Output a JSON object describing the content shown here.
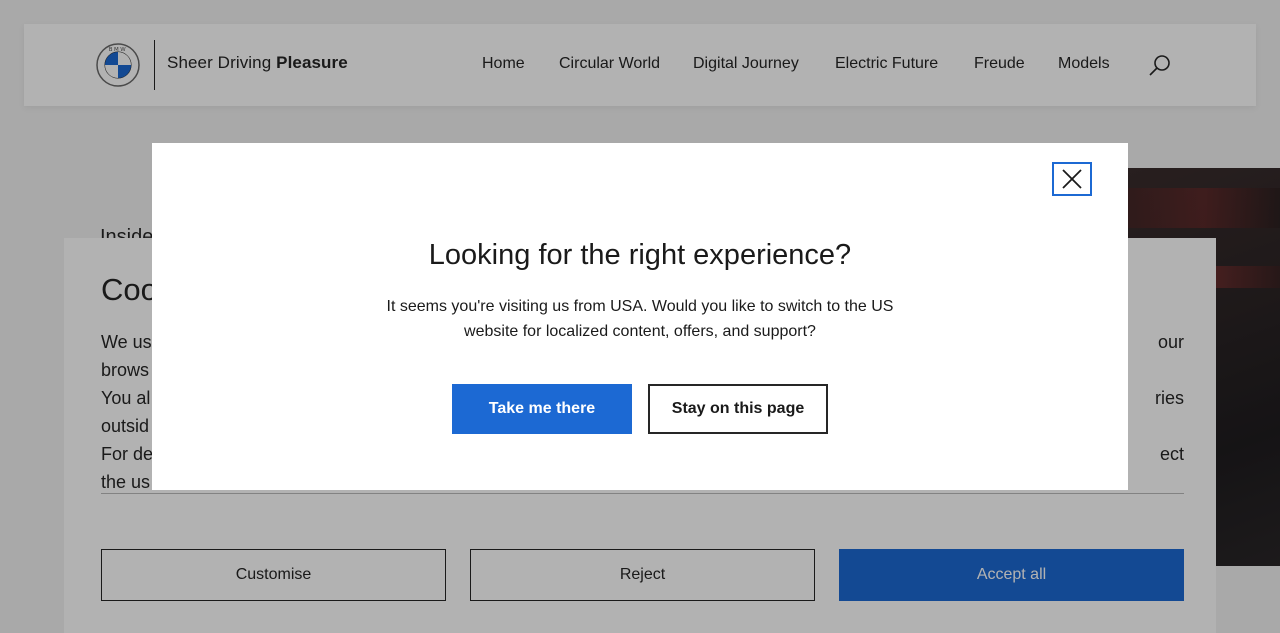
{
  "header": {
    "tagline_regular": "Sheer Driving",
    "tagline_bold": "Pleasure",
    "nav": [
      "Home",
      "Circular World",
      "Digital Journey",
      "Electric Future",
      "Freude",
      "Models"
    ],
    "search_icon": "search-icon",
    "logo_letters": "BMW"
  },
  "hero": {
    "teaser_text": "Inside"
  },
  "cookie_banner": {
    "title": "Coo",
    "line1_start": "We us",
    "line1_end": "our",
    "line2_start": "brows",
    "line3_start": "You al",
    "line3_end": "ries",
    "line4_start": "outsid",
    "line5_start": "For de",
    "line5_end": "ect",
    "line6_start": "the us",
    "customise_label": "Customise",
    "reject_label": "Reject",
    "accept_label": "Accept all"
  },
  "modal": {
    "title": "Looking for the right experience?",
    "body": "It seems you're visiting us from USA. Would you like to switch to the US website for localized content, offers, and support?",
    "primary_label": "Take me there",
    "secondary_label": "Stay on this page",
    "close_icon": "close-icon"
  },
  "colors": {
    "accent": "#1c69d3",
    "text": "#262626",
    "overlay": "rgba(0,0,0,0.30)"
  }
}
